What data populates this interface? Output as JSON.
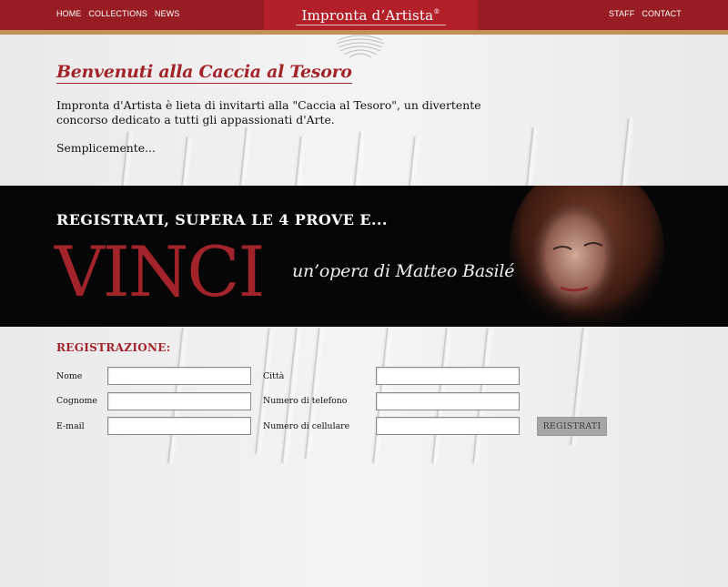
{
  "nav_left": [
    "HOME",
    "COLLECTIONS",
    "NEWS"
  ],
  "nav_right": [
    "STAFF",
    "CONTACT"
  ],
  "brand": {
    "name": "Impronta d’Artista",
    "mark": "®"
  },
  "intro": {
    "title": "Benvenuti alla Caccia al Tesoro",
    "text": "Impronta d'Artista è lieta di invitarti alla \"Caccia al Tesoro\", un divertente concorso dedicato a tutti gli appassionati d'Arte.",
    "more": "Semplicemente..."
  },
  "banner": {
    "headline": "REGISTRATI, SUPERA LE 4 PROVE E...",
    "vinci": "VINCI",
    "subtitle": "un’opera di Matteo Basilé"
  },
  "registration": {
    "title": "REGISTRAZIONE:",
    "fields": {
      "nome": {
        "label": "Nome",
        "value": ""
      },
      "cognome": {
        "label": "Cognome",
        "value": ""
      },
      "email": {
        "label": "E-mail",
        "value": ""
      },
      "citta": {
        "label": "Città",
        "value": ""
      },
      "telefono": {
        "label": "Numero di telefono",
        "value": ""
      },
      "cellulare": {
        "label": "Numero di cellulare",
        "value": ""
      }
    },
    "submit_label": "REGISTRATI"
  },
  "colors": {
    "accent": "#a3232a",
    "topbar": "#981d22",
    "stripe": "#c2915a"
  }
}
